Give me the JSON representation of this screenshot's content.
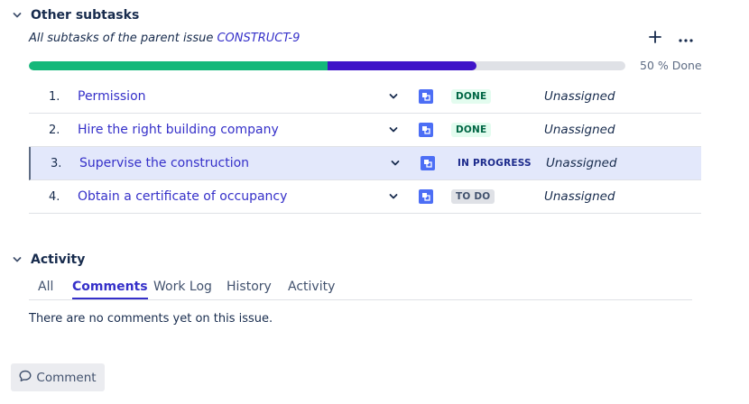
{
  "subtasks": {
    "title": "Other subtasks",
    "subtitle_prefix": "All subtasks of the parent issue ",
    "parent_key": "CONSTRUCT-9",
    "progress": {
      "done_fraction": 0.5,
      "in_progress_fraction": 0.25,
      "label": "50 % Done",
      "done_color": "#14b87a",
      "in_progress_color": "#3f14c8"
    },
    "icons": {
      "add": "plus-icon",
      "more": "more-icon",
      "collapse": "chevron-down-icon"
    },
    "items": [
      {
        "num": "1.",
        "summary": "Permission",
        "status": "DONE",
        "status_kind": "done",
        "assignee": "Unassigned"
      },
      {
        "num": "2.",
        "summary": "Hire the right building company",
        "status": "DONE",
        "status_kind": "done",
        "assignee": "Unassigned"
      },
      {
        "num": "3.",
        "summary": "Supervise the construction",
        "status": "IN PROGRESS",
        "status_kind": "inprogress",
        "assignee": "Unassigned"
      },
      {
        "num": "4.",
        "summary": "Obtain a certificate of occupancy",
        "status": "TO DO",
        "status_kind": "todo",
        "assignee": "Unassigned"
      }
    ]
  },
  "activity": {
    "title": "Activity",
    "tabs": [
      "All",
      "Comments",
      "Work Log",
      "History",
      "Activity"
    ],
    "active_tab": "Comments",
    "empty_text": "There are no comments yet on this issue.",
    "comment_button": "Comment"
  },
  "colors": {
    "link": "#3530c9",
    "subtask_icon": "#4c6ef5",
    "selected_row": "#e3e8fb"
  }
}
